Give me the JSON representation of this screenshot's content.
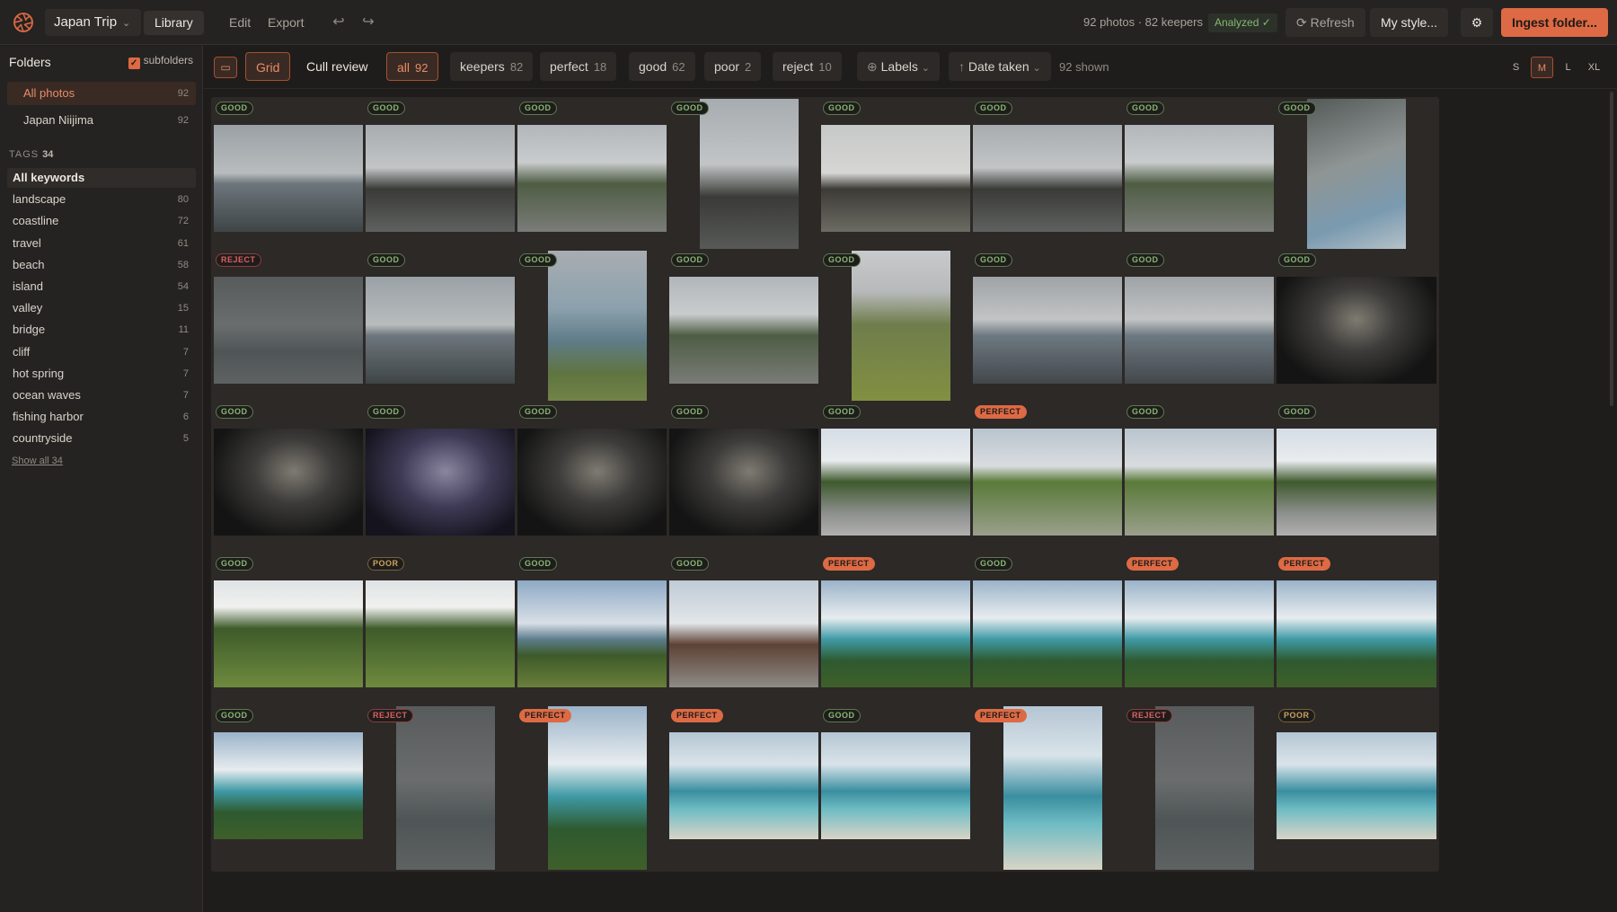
{
  "header": {
    "project": "Japan Trip",
    "nav": [
      "Library",
      "Edit",
      "Export"
    ],
    "stats": "92 photos · 82 keepers",
    "analyzed": "Analyzed ✓",
    "refresh": "Refresh",
    "my_style": "My style...",
    "ingest": "Ingest folder..."
  },
  "sidebar": {
    "folders_title": "Folders",
    "subfolders": "subfolders",
    "folders": [
      {
        "name": "All photos",
        "count": "92"
      },
      {
        "name": "Japan Niijima",
        "count": "92"
      }
    ],
    "tags_title": "TAGS",
    "tags_count": "34",
    "tags": [
      {
        "name": "All keywords",
        "count": ""
      },
      {
        "name": "landscape",
        "count": "80"
      },
      {
        "name": "coastline",
        "count": "72"
      },
      {
        "name": "travel",
        "count": "61"
      },
      {
        "name": "beach",
        "count": "58"
      },
      {
        "name": "island",
        "count": "54"
      },
      {
        "name": "valley",
        "count": "15"
      },
      {
        "name": "bridge",
        "count": "11"
      },
      {
        "name": "cliff",
        "count": "7"
      },
      {
        "name": "hot spring",
        "count": "7"
      },
      {
        "name": "ocean waves",
        "count": "7"
      },
      {
        "name": "fishing harbor",
        "count": "6"
      },
      {
        "name": "countryside",
        "count": "5"
      }
    ],
    "show_all": "Show all 34"
  },
  "filterbar": {
    "view_grid": "Grid",
    "view_cull": "Cull review",
    "filters": [
      {
        "label": "all",
        "count": "92"
      },
      {
        "label": "keepers",
        "count": "82"
      },
      {
        "label": "perfect",
        "count": "18"
      },
      {
        "label": "good",
        "count": "62"
      },
      {
        "label": "poor",
        "count": "2"
      },
      {
        "label": "reject",
        "count": "10"
      }
    ],
    "labels": "Labels",
    "date_taken": "Date taken",
    "sort_arrow": "↑",
    "shown": "92 shown",
    "sizes": [
      "S",
      "M",
      "L",
      "XL"
    ],
    "active_size": "M"
  },
  "photos": [
    {
      "label": "GOOD",
      "orient": "land",
      "scene": "sea"
    },
    {
      "label": "GOOD",
      "orient": "land",
      "scene": "rock"
    },
    {
      "label": "GOOD",
      "orient": "land",
      "scene": "coast"
    },
    {
      "label": "GOOD",
      "orient": "port",
      "scene": "rock"
    },
    {
      "label": "GOOD",
      "orient": "land",
      "scene": "dark-land"
    },
    {
      "label": "GOOD",
      "orient": "land",
      "scene": "rock"
    },
    {
      "label": "GOOD",
      "orient": "land",
      "scene": "coast"
    },
    {
      "label": "GOOD",
      "orient": "port",
      "scene": "cliff"
    },
    {
      "label": "REJECT",
      "orient": "land",
      "scene": "gray"
    },
    {
      "label": "GOOD",
      "orient": "land",
      "scene": "sea"
    },
    {
      "label": "GOOD",
      "orient": "port",
      "scene": "grass-sea"
    },
    {
      "label": "GOOD",
      "orient": "land",
      "scene": "coast"
    },
    {
      "label": "GOOD",
      "orient": "port",
      "scene": "grass"
    },
    {
      "label": "GOOD",
      "orient": "land",
      "scene": "harbor"
    },
    {
      "label": "GOOD",
      "orient": "land",
      "scene": "harbor"
    },
    {
      "label": "GOOD",
      "orient": "land",
      "scene": "night"
    },
    {
      "label": "GOOD",
      "orient": "land",
      "scene": "night"
    },
    {
      "label": "GOOD",
      "orient": "land",
      "scene": "night-purple"
    },
    {
      "label": "GOOD",
      "orient": "land",
      "scene": "night"
    },
    {
      "label": "GOOD",
      "orient": "land",
      "scene": "night"
    },
    {
      "label": "GOOD",
      "orient": "land",
      "scene": "road"
    },
    {
      "label": "PERFECT",
      "orient": "land",
      "scene": "park"
    },
    {
      "label": "GOOD",
      "orient": "land",
      "scene": "park"
    },
    {
      "label": "GOOD",
      "orient": "land",
      "scene": "road"
    },
    {
      "label": "GOOD",
      "orient": "land",
      "scene": "green"
    },
    {
      "label": "POOR",
      "orient": "land",
      "scene": "green"
    },
    {
      "label": "GOOD",
      "orient": "land",
      "scene": "sky-green"
    },
    {
      "label": "GOOD",
      "orient": "land",
      "scene": "tower"
    },
    {
      "label": "PERFECT",
      "orient": "land",
      "scene": "bay"
    },
    {
      "label": "GOOD",
      "orient": "land",
      "scene": "bay"
    },
    {
      "label": "PERFECT",
      "orient": "land",
      "scene": "bay"
    },
    {
      "label": "PERFECT",
      "orient": "land",
      "scene": "bay"
    },
    {
      "label": "GOOD",
      "orient": "land",
      "scene": "bay"
    },
    {
      "label": "REJECT",
      "orient": "port",
      "scene": "gray"
    },
    {
      "label": "PERFECT",
      "orient": "port",
      "scene": "bay"
    },
    {
      "label": "PERFECT",
      "orient": "land",
      "scene": "beach"
    },
    {
      "label": "GOOD",
      "orient": "land",
      "scene": "beach"
    },
    {
      "label": "PERFECT",
      "orient": "port",
      "scene": "beach"
    },
    {
      "label": "REJECT",
      "orient": "port",
      "scene": "gray"
    },
    {
      "label": "POOR",
      "orient": "land",
      "scene": "beach"
    }
  ]
}
